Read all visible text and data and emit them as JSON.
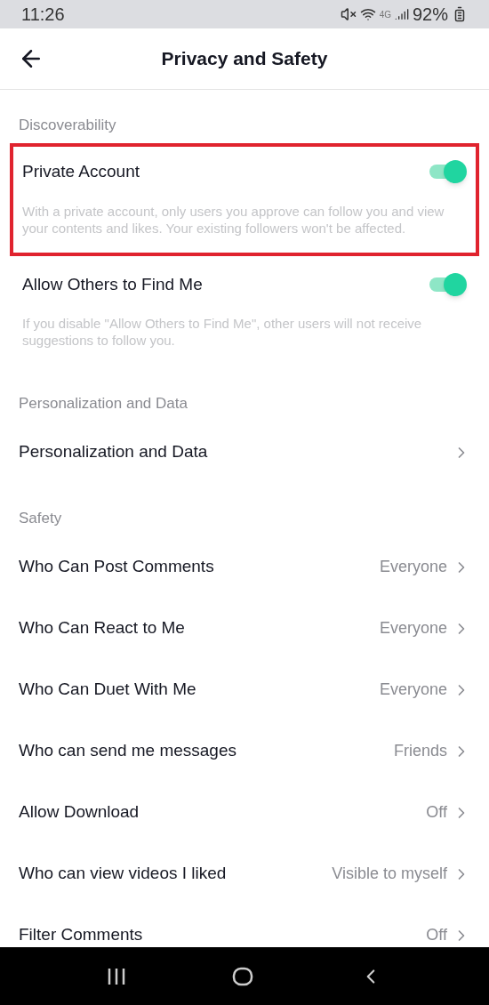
{
  "status_bar": {
    "time": "11:26",
    "network": "4G",
    "battery": "92%"
  },
  "header": {
    "title": "Privacy and Safety"
  },
  "sections": [
    {
      "heading": "Discoverability",
      "items": [
        {
          "kind": "toggle",
          "label": "Private Account",
          "on": true,
          "highlighted": true,
          "description": "With a private account, only users you approve can follow you and view your contents and likes. Your existing followers won't be affected."
        },
        {
          "kind": "toggle",
          "label": "Allow Others to Find Me",
          "on": true,
          "description": "If you disable \"Allow Others to Find Me\", other users will not receive suggestions to follow you."
        }
      ]
    },
    {
      "heading": "Personalization and Data",
      "items": [
        {
          "kind": "link",
          "label": "Personalization and Data"
        }
      ]
    },
    {
      "heading": "Safety",
      "items": [
        {
          "kind": "link",
          "label": "Who Can Post Comments",
          "value": "Everyone"
        },
        {
          "kind": "link",
          "label": "Who Can React to Me",
          "value": "Everyone"
        },
        {
          "kind": "link",
          "label": "Who Can Duet With Me",
          "value": "Everyone"
        },
        {
          "kind": "link",
          "label": "Who can send me messages",
          "value": "Friends"
        },
        {
          "kind": "link",
          "label": "Allow Download",
          "value": "Off"
        },
        {
          "kind": "link",
          "label": "Who can view videos I liked",
          "value": "Visible to myself"
        },
        {
          "kind": "link",
          "label": "Filter Comments",
          "value": "Off"
        }
      ]
    }
  ]
}
